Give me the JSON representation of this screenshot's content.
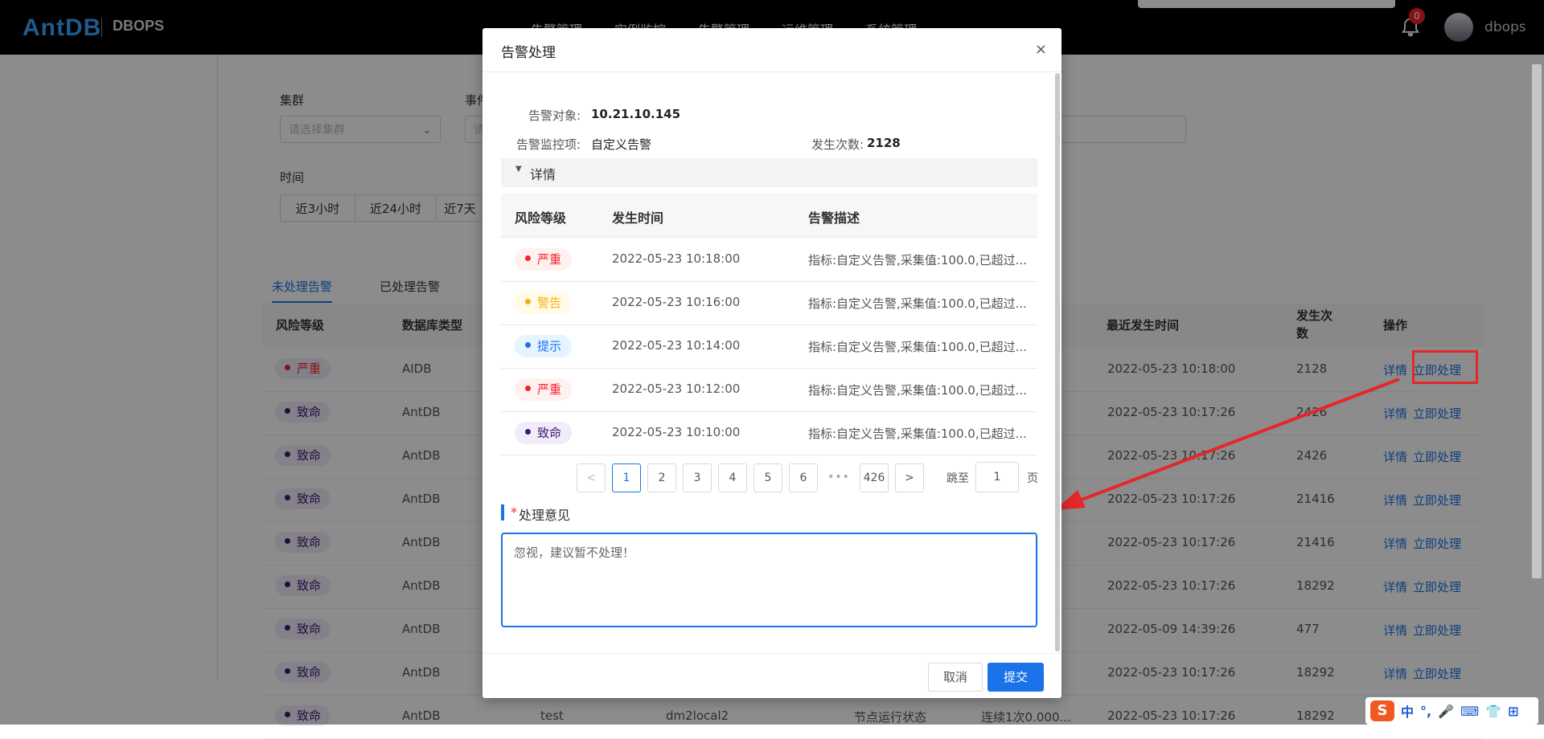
{
  "header": {
    "logo": "AntDB",
    "logo_sub": "DBOPS",
    "nav": [
      "告警管理",
      "实例监控",
      "告警管理",
      "运维管理",
      "系统管理"
    ],
    "notification_count": "0",
    "username": "dbops"
  },
  "filters": {
    "cluster_label": "集群",
    "cluster_placeholder": "请选择集群",
    "event_label": "事件",
    "event_placeholder": "请",
    "time_label": "时间",
    "time_buttons": [
      "近3小时",
      "近24小时",
      "近7天"
    ]
  },
  "tabs": [
    "未处理告警",
    "已处理告警"
  ],
  "table": {
    "headers": [
      "风险等级",
      "数据库类型",
      "最近发生时间",
      "发生次数",
      "操作"
    ],
    "detail_link": "详情",
    "handle_link": "立即处理",
    "rows": [
      {
        "level": "严重",
        "level_color": "#f5222d",
        "db": "AIDB",
        "obj": "",
        "item": "",
        "desc": "..",
        "time": "2022-05-23 10:18:00",
        "count": "2128"
      },
      {
        "level": "致命",
        "level_color": "#3a1a73",
        "db": "AntDB",
        "obj": "",
        "item": "",
        "desc": "..",
        "time": "2022-05-23 10:17:26",
        "count": "2426"
      },
      {
        "level": "致命",
        "level_color": "#3a1a73",
        "db": "AntDB",
        "obj": "",
        "item": "",
        "desc": "..",
        "time": "2022-05-23 10:17:26",
        "count": "2426"
      },
      {
        "level": "致命",
        "level_color": "#3a1a73",
        "db": "AntDB",
        "obj": "",
        "item": "",
        "desc": "..",
        "time": "2022-05-23 10:17:26",
        "count": "21416"
      },
      {
        "level": "致命",
        "level_color": "#3a1a73",
        "db": "AntDB",
        "obj": "",
        "item": "",
        "desc": "..",
        "time": "2022-05-23 10:17:26",
        "count": "21416"
      },
      {
        "level": "致命",
        "level_color": "#3a1a73",
        "db": "AntDB",
        "obj": "",
        "item": "",
        "desc": "..",
        "time": "2022-05-23 10:17:26",
        "count": "18292"
      },
      {
        "level": "致命",
        "level_color": "#3a1a73",
        "db": "AntDB",
        "obj": "",
        "item": "",
        "desc": "..",
        "time": "2022-05-09 14:39:26",
        "count": "477"
      },
      {
        "level": "致命",
        "level_color": "#3a1a73",
        "db": "AntDB",
        "obj": "",
        "item": "",
        "desc": "..",
        "time": "2022-05-23 10:17:26",
        "count": "18292"
      },
      {
        "level": "致命",
        "level_color": "#3a1a73",
        "db": "AntDB",
        "obj": "test",
        "item": "dm2local2",
        "node": "节点运行状态",
        "desc": "连续1次0.000...",
        "time": "2022-05-23 10:17:26",
        "count": "18292"
      }
    ]
  },
  "modal": {
    "title": "告警处理",
    "close": "×",
    "target_label": "告警对象:",
    "target_value": "10.21.10.145",
    "monitor_label": "告警监控项:",
    "monitor_value": "自定义告警",
    "count_label": "发生次数:",
    "count_value": "2128",
    "collapse_label": "详情",
    "detail_headers": [
      "风险等级",
      "发生时间",
      "告警描述"
    ],
    "detail_rows": [
      {
        "level": "严重",
        "color": "#f5222d",
        "bg": "#fff1f0",
        "time": "2022-05-23 10:18:00",
        "desc": "指标:自定义告警,采集值:100.0,已超过..."
      },
      {
        "level": "警告",
        "color": "#faad14",
        "bg": "#fffbe6",
        "time": "2022-05-23 10:16:00",
        "desc": "指标:自定义告警,采集值:100.0,已超过..."
      },
      {
        "level": "提示",
        "color": "#1a73e8",
        "bg": "#e6f4ff",
        "time": "2022-05-23 10:14:00",
        "desc": "指标:自定义告警,采集值:100.0,已超过..."
      },
      {
        "level": "严重",
        "color": "#f5222d",
        "bg": "#fff1f0",
        "time": "2022-05-23 10:12:00",
        "desc": "指标:自定义告警,采集值:100.0,已超过..."
      },
      {
        "level": "致命",
        "color": "#3a1a73",
        "bg": "#f0ecfa",
        "time": "2022-05-23 10:10:00",
        "desc": "指标:自定义告警,采集值:100.0,已超过..."
      }
    ],
    "pagination": {
      "prev": "<",
      "pages": [
        "1",
        "2",
        "3",
        "4",
        "5",
        "6"
      ],
      "ellipsis": "•••",
      "last": "426",
      "next": ">",
      "jump_label": "跳至",
      "jump_value": "1",
      "jump_unit": "页"
    },
    "opinion_required": "*",
    "opinion_label": "处理意见",
    "opinion_value": "忽视，建议暂不处理！",
    "cancel": "取消",
    "submit": "提交"
  },
  "ime": {
    "s": "S",
    "items": [
      "中",
      "°,",
      "🎤",
      "⌨",
      "👕",
      "⊞"
    ]
  }
}
